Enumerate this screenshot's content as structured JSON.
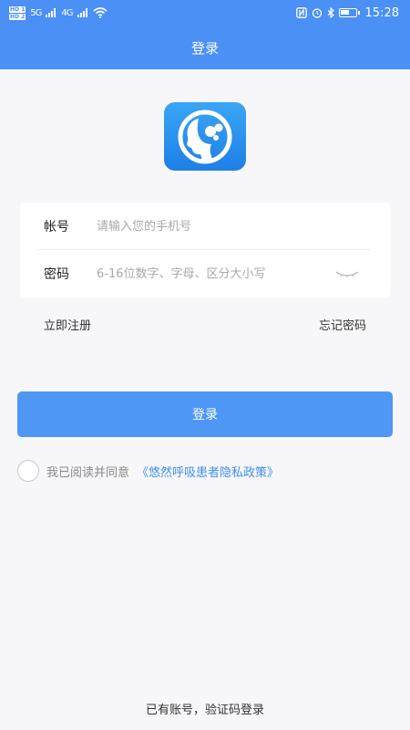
{
  "status_bar": {
    "sim1": "HD 1",
    "sim2": "HD 2",
    "network1": "5G",
    "network2": "4G",
    "time": "15:28"
  },
  "navbar": {
    "title": "登录"
  },
  "form": {
    "account_label": "帐号",
    "account_placeholder": "请输入您的手机号",
    "password_label": "密码",
    "password_placeholder": "6-16位数字、字母、区分大小写"
  },
  "links": {
    "register": "立即注册",
    "forgot": "忘记密码"
  },
  "login_button": "登录",
  "agreement": {
    "text": "我已阅读并同意",
    "policy": "《悠然呼吸患者隐私政策》"
  },
  "footer": {
    "sms_login": "已有账号，验证码登录"
  },
  "colors": {
    "primary": "#4a90f5",
    "link": "#3e8ef0"
  }
}
